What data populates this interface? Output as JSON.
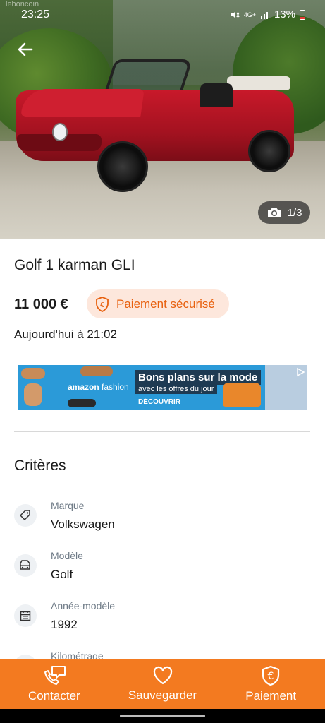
{
  "status_bar": {
    "watermark": "leboncoin",
    "time": "23:25",
    "network": "4G+",
    "battery": "13%"
  },
  "photo": {
    "counter": "1/3"
  },
  "listing": {
    "title": "Golf 1 karman GLI",
    "price": "11 000 €",
    "secure_payment_label": "Paiement sécurisé",
    "date": "Aujourd'hui à 21:02"
  },
  "ad": {
    "brand_part1": "amazon",
    "brand_part2": " fashion",
    "headline": "Bons plans sur la mode",
    "subline": "avec les offres du jour",
    "cta": "DÉCOUVRIR"
  },
  "criteria": {
    "title": "Critères",
    "items": [
      {
        "label": "Marque",
        "value": "Volkswagen",
        "icon": "tag-icon"
      },
      {
        "label": "Modèle",
        "value": "Golf",
        "icon": "car-icon"
      },
      {
        "label": "Année-modèle",
        "value": "1992",
        "icon": "calendar-icon"
      },
      {
        "label": "Kilométrage",
        "value": "",
        "icon": "speedometer-icon"
      }
    ]
  },
  "bottom_bar": {
    "contact": "Contacter",
    "save": "Sauvegarder",
    "payment": "Paiement"
  },
  "colors": {
    "accent": "#f37a20",
    "secure_bg": "#fde7dc",
    "secure_text": "#e8600e"
  }
}
